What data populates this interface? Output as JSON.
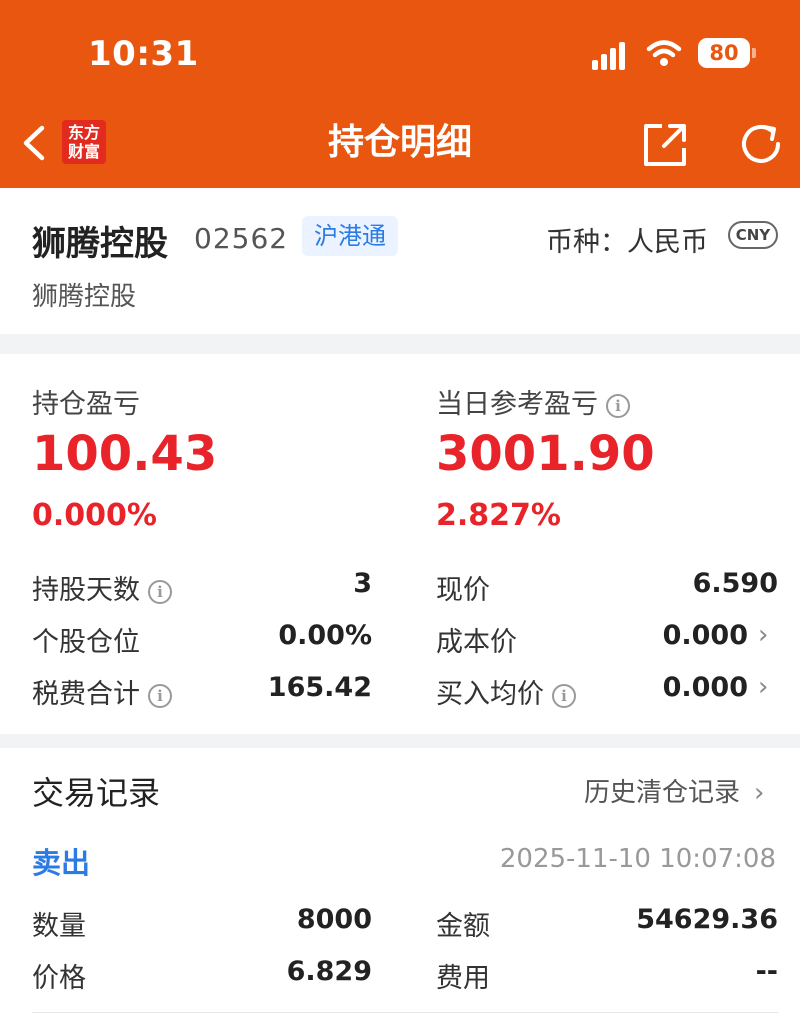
{
  "status_bar": {
    "time": "10:31",
    "battery": "80"
  },
  "nav": {
    "title": "持仓明细",
    "logo_line1": "东方",
    "logo_line2": "财富"
  },
  "stock": {
    "name": "狮腾控股",
    "code": "02562",
    "market": "沪港通",
    "currency_label": "币种：人民币",
    "currency_code": "CNY",
    "sub_name": "狮腾控股"
  },
  "position": {
    "pnl_label": "持仓盈亏",
    "pnl_value": "100.43",
    "pnl_pct": "0.000%",
    "daily_label": "当日参考盈亏",
    "daily_value": "3001.90",
    "daily_pct": "2.827%",
    "rows_left": [
      {
        "label": "持股天数",
        "value": "3",
        "info": true
      },
      {
        "label": "个股仓位",
        "value": "0.00%",
        "info": false
      },
      {
        "label": "税费合计",
        "value": "165.42",
        "info": true
      }
    ],
    "rows_right": [
      {
        "label": "现价",
        "value": "6.590",
        "info": false
      },
      {
        "label": "成本价",
        "value": "0.000",
        "info": false
      },
      {
        "label": "买入均价",
        "value": "0.000",
        "info": true
      }
    ]
  },
  "trades": {
    "title": "交易记录",
    "history_link": "历史清仓记录",
    "records": [
      {
        "type": "卖出",
        "datetime": "2025-11-10 10:07:08",
        "qty_label": "数量",
        "qty": "8000",
        "amount_label": "金额",
        "amount": "54629.36",
        "price_label": "价格",
        "price": "6.829",
        "fee_label": "费用",
        "fee": "--"
      }
    ]
  },
  "colors": {
    "brand": "#e9560f",
    "rise": "#e8242a",
    "link": "#2b7be4"
  },
  "icons": [
    "back-icon",
    "share-icon",
    "refresh-icon",
    "info-icon",
    "chevron-right-icon",
    "wifi-icon",
    "signal-icon",
    "battery-icon"
  ]
}
